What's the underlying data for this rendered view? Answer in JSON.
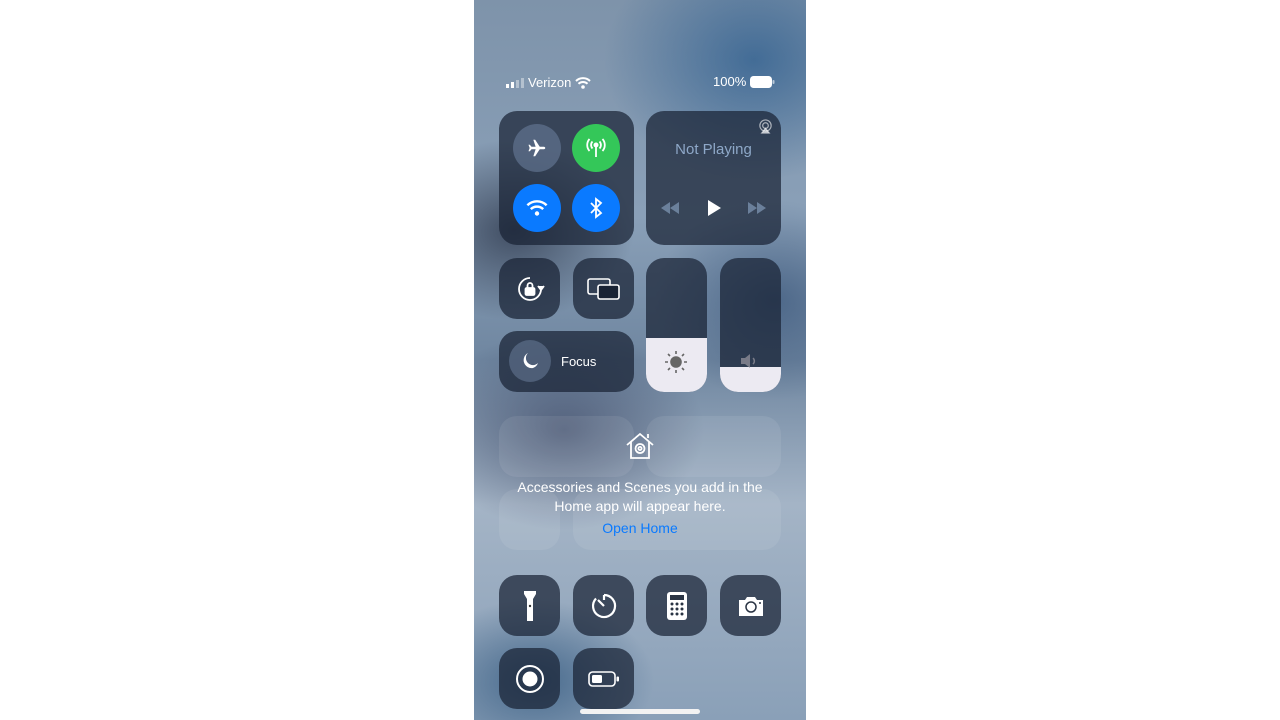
{
  "status_bar": {
    "carrier": "Verizon",
    "battery": "100%",
    "signal_bars": 2,
    "icons": [
      "cellular-signal-icon",
      "wifi-icon",
      "battery-icon"
    ]
  },
  "connectivity": {
    "airplane": {
      "icon": "airplane-icon",
      "on": false
    },
    "cellular": {
      "icon": "cellular-antenna-icon",
      "on": true,
      "color": "#34c759"
    },
    "wifi": {
      "icon": "wifi-icon",
      "on": true,
      "color": "#0a7aff"
    },
    "bluetooth": {
      "icon": "bluetooth-icon",
      "on": true,
      "color": "#0a7aff"
    }
  },
  "media": {
    "title": "Not Playing",
    "icons": [
      "airplay-icon",
      "rewind-icon",
      "play-icon",
      "fast-forward-icon"
    ]
  },
  "controls": {
    "orientation_lock": "orientation-lock-icon",
    "screen_mirroring": "screen-mirroring-icon"
  },
  "focus": {
    "label": "Focus",
    "icon": "moon-icon"
  },
  "brightness": {
    "level": 0.4,
    "icon": "sun-icon"
  },
  "volume": {
    "level": 0.19,
    "icon": "speaker-icon"
  },
  "home": {
    "message_line1": "Accessories and Scenes you add in the",
    "message_line2": "Home app will appear here.",
    "link": "Open Home",
    "link_color": "#0a7aff",
    "icon": "home-icon"
  },
  "shortcuts": [
    "flashlight-icon",
    "timer-icon",
    "calculator-icon",
    "camera-icon",
    "screen-record-icon",
    "low-power-mode-icon"
  ]
}
